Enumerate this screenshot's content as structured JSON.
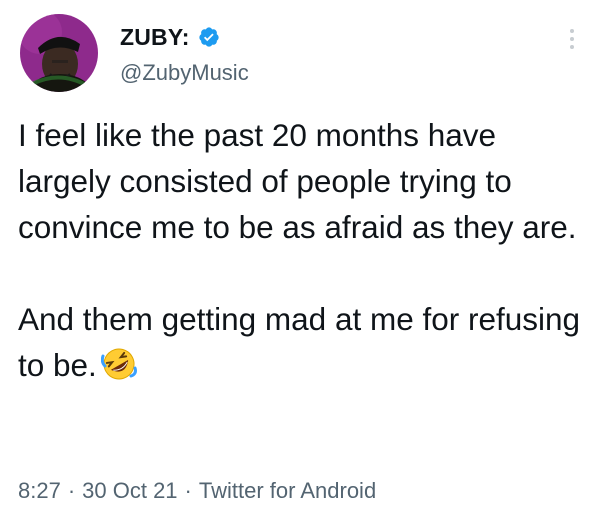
{
  "author": {
    "display_name": "ZUBY:",
    "handle": "@ZubyMusic",
    "verified": true,
    "avatar_icon": "avatar-icon"
  },
  "tweet": {
    "paragraphs": [
      "I feel like the past 20 months have largely consisted of people trying to convince me to be as afraid as they are.",
      "And them getting mad at me for refusing to be."
    ],
    "emoji": "rolling-on-floor-laughing-emoji"
  },
  "meta": {
    "time": "8:27",
    "date": "30 Oct 21",
    "source": "Twitter for Android",
    "separator": "·"
  },
  "colors": {
    "text": "#0f1419",
    "secondary": "#536471",
    "verified": "#1d9bf0",
    "avatar_bg": "#8e2a8c"
  }
}
